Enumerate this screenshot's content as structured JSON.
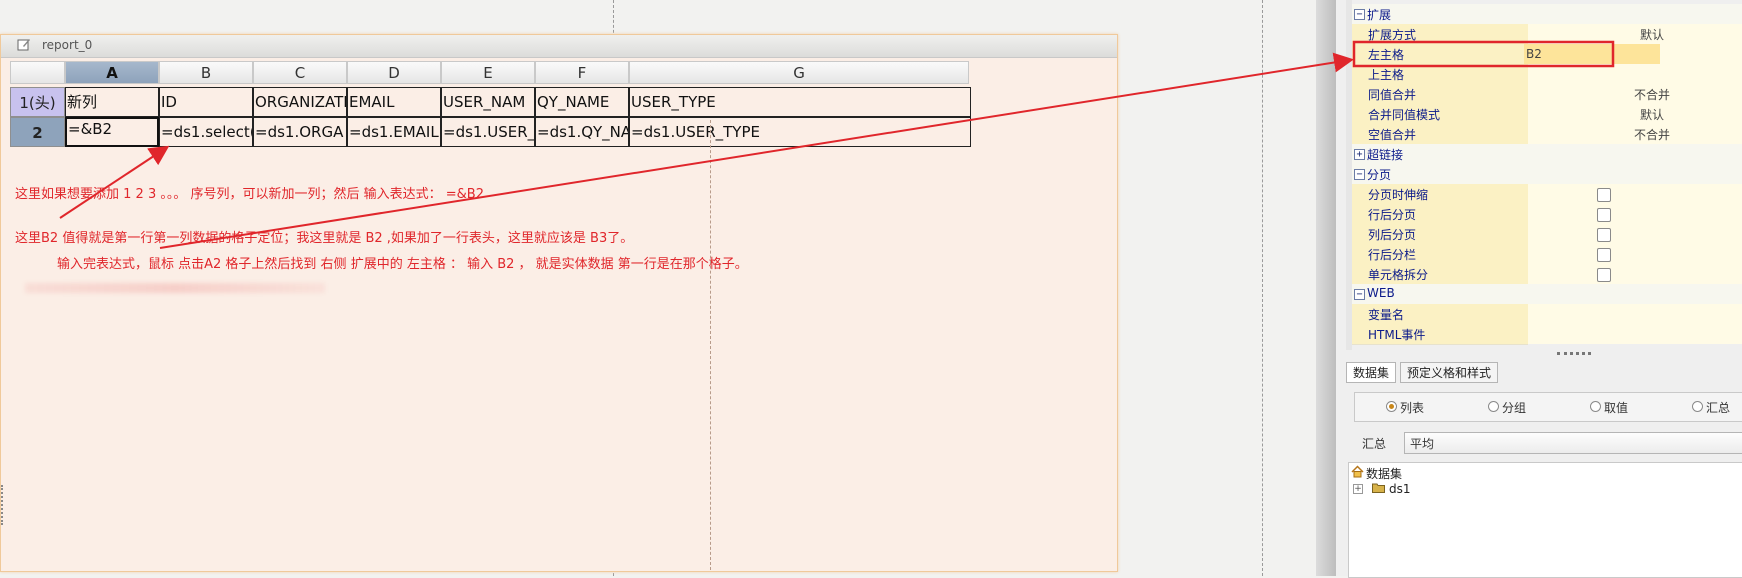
{
  "report": {
    "title": "report_0"
  },
  "grid": {
    "columns": [
      "A",
      "B",
      "C",
      "D",
      "E",
      "F",
      "G"
    ],
    "rows": [
      {
        "header": "1(头)",
        "cells": [
          "新列",
          "ID",
          "ORGANIZATI",
          "EMAIL",
          "USER_NAM",
          "QY_NAME",
          "USER_TYPE"
        ]
      },
      {
        "header": "2",
        "cells": [
          "=&B2",
          "=ds1.select(I",
          "=ds1.ORGA",
          "=ds1.EMAIL",
          "=ds1.USER_",
          "=ds1.QY_NA",
          "=ds1.USER_TYPE"
        ]
      }
    ]
  },
  "notes": [
    "这里如果想要添加 1 2 3 。。。 序号列，可以新加一列；然后 输入表达式： =&B2",
    "这里B2  值得就是第一行第一列数据的格子定位；我这里就是 B2 ,如果加了一行表头，这里就应该是 B3了。",
    "输入完表达式，鼠标   点击A2 格子上然后找到 右侧 扩展中的  左主格 ： 输入 B2 ， 就是实体数据 第一行是在那个格子。"
  ],
  "properties": {
    "rows": [
      {
        "kind": "group",
        "label": "扩展",
        "toggle": "−"
      },
      {
        "kind": "item",
        "label": "扩展方式",
        "value": "默认"
      },
      {
        "kind": "item",
        "label": "左主格",
        "value": "B2",
        "highlight": true
      },
      {
        "kind": "item",
        "label": "上主格",
        "value": ""
      },
      {
        "kind": "item",
        "label": "同值合并",
        "value": "不合并"
      },
      {
        "kind": "item",
        "label": "合并同值模式",
        "value": "默认"
      },
      {
        "kind": "item",
        "label": "空值合并",
        "value": "不合并"
      },
      {
        "kind": "group",
        "label": "超链接",
        "toggle": "+"
      },
      {
        "kind": "group",
        "label": "分页",
        "toggle": "−"
      },
      {
        "kind": "item",
        "label": "分页时伸缩",
        "checkbox": true
      },
      {
        "kind": "item",
        "label": "行后分页",
        "checkbox": true
      },
      {
        "kind": "item",
        "label": "列后分页",
        "checkbox": true
      },
      {
        "kind": "item",
        "label": "行后分栏",
        "checkbox": true
      },
      {
        "kind": "item",
        "label": "单元格拆分",
        "checkbox": true
      },
      {
        "kind": "group",
        "label": "WEB",
        "toggle": "−"
      },
      {
        "kind": "item",
        "label": "变量名",
        "value": ""
      },
      {
        "kind": "item",
        "label": "HTML事件",
        "value": ""
      }
    ]
  },
  "bottom_panel": {
    "tabs": [
      "数据集",
      "预定义格和样式"
    ],
    "radios": [
      {
        "label": "列表",
        "selected": true
      },
      {
        "label": "分组",
        "selected": false
      },
      {
        "label": "取值",
        "selected": false
      },
      {
        "label": "汇总",
        "selected": false
      }
    ],
    "summary_label": "汇总",
    "summary_value": "平均",
    "tree": {
      "root": "数据集",
      "child": "ds1"
    }
  },
  "colors": {
    "annotation": "#e0262b",
    "selected_header": "#8ea3bb",
    "highlight_cell": "#fde49a"
  }
}
